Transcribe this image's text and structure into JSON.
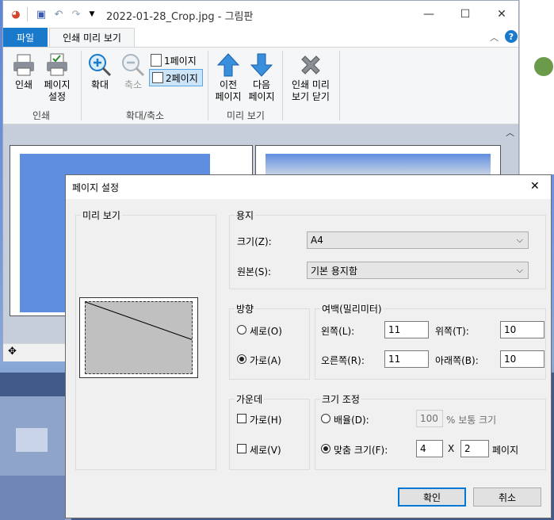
{
  "paint": {
    "title": "2022-01-28_Crop.jpg - 그림판",
    "tabs": {
      "file": "파일",
      "print_preview": "인쇄 미리 보기"
    },
    "ribbon": {
      "print": "인쇄",
      "page_setup_1": "페이지",
      "page_setup_2": "설정",
      "zoom_in": "확대",
      "zoom_out": "축소",
      "one_page": "1페이지",
      "two_page": "2페이지",
      "prev_1": "이전",
      "prev_2": "페이지",
      "next_1": "다음",
      "next_2": "페이지",
      "close_1": "인쇄 미리",
      "close_2": "보기 닫기",
      "group_print": "인쇄",
      "group_zoom": "확대/축소",
      "group_preview": "미리 보기"
    }
  },
  "dialog": {
    "title": "페이지 설정",
    "preview_label": "미리 보기",
    "paper": {
      "legend": "용지",
      "size_label": "크기(Z):",
      "size_value": "A4",
      "source_label": "원본(S):",
      "source_value": "기본 용지함"
    },
    "orientation": {
      "legend": "방향",
      "portrait": "세로(O)",
      "landscape": "가로(A)",
      "selected": "landscape"
    },
    "margins": {
      "legend": "여백(밀리미터)",
      "left_label": "왼쪽(L):",
      "left_value": "11",
      "top_label": "위쪽(T):",
      "top_value": "10",
      "right_label": "오른쪽(R):",
      "right_value": "11",
      "bottom_label": "아래쪽(B):",
      "bottom_value": "10"
    },
    "centering": {
      "legend": "가운데",
      "horizontal": "가로(H)",
      "vertical": "세로(V)"
    },
    "scaling": {
      "legend": "크기 조정",
      "adjust_label": "배율(D):",
      "adjust_value": "100",
      "adjust_suffix": "% 보통 크기",
      "fit_label": "맞춤 크기(F):",
      "fit_w": "4",
      "fit_x": "X",
      "fit_h": "2",
      "fit_suffix": "페이지"
    },
    "ok": "확인",
    "cancel": "취소"
  }
}
